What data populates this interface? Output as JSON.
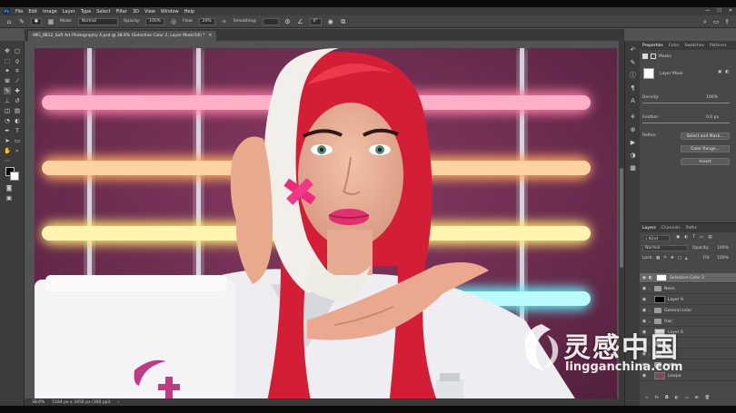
{
  "app": {
    "logo_text": "Ps",
    "menu": [
      "File",
      "Edit",
      "Image",
      "Layer",
      "Type",
      "Select",
      "Filter",
      "3D",
      "View",
      "Window",
      "Help"
    ]
  },
  "options": {
    "mode_label": "Mode:",
    "mode_value": "Normal",
    "opacity_label": "Opacity:",
    "opacity_value": "100%",
    "flow_label": "Flow:",
    "flow_value": "20%",
    "smoothing_label": "Smoothing:",
    "angle_value": "0°"
  },
  "document": {
    "tab_title": "IMG_8812_Soft Art Photography 4.psd @ 38.6% (Selective Color 2, Layer Mask/16) *"
  },
  "properties": {
    "tabs": [
      "Properties",
      "Color",
      "Swatches",
      "Patterns"
    ],
    "section": "Masks",
    "mask_label": "Layer Mask",
    "density_label": "Density:",
    "density_value": "100%",
    "feather_label": "Feather:",
    "feather_value": "0.0 px",
    "refine_label": "Refine:",
    "buttons": [
      "Select and Mask...",
      "Color Range...",
      "Invert"
    ]
  },
  "layers": {
    "tabs": [
      "Layers",
      "Channels",
      "Paths"
    ],
    "kind_value": "Kind",
    "blend_value": "Normal",
    "opacity_label": "Opacity:",
    "opacity_value": "100%",
    "lock_label": "Lock:",
    "fill_label": "Fill:",
    "fill_value": "100%",
    "items": [
      {
        "name": "Selective Color 2",
        "type": "adjust"
      },
      {
        "name": "Neon",
        "type": "folder"
      },
      {
        "name": "Layer 9",
        "type": "black"
      },
      {
        "name": "General color",
        "type": "folder"
      },
      {
        "name": "Hair",
        "type": "folder"
      },
      {
        "name": "Layer 6",
        "type": "light"
      },
      {
        "name": "",
        "type": "folder"
      },
      {
        "name": "",
        "type": "folder"
      },
      {
        "name": "teeth",
        "type": "folder"
      },
      {
        "name": "Lowpa",
        "type": "pic"
      }
    ]
  },
  "status": {
    "zoom": "38.6%",
    "doc_size": "5184 px x 3456 px (300 ppi)"
  },
  "watermark": {
    "chinese": "灵感中国",
    "english": "lingganchina.com"
  },
  "colors": {
    "panel_bg": "#484848",
    "canvas_bg": "#6a2b4a",
    "neon_pink": "#ff8fb0",
    "neon_orange": "#ffb870",
    "neon_yellow": "#fff19a",
    "neon_cyan": "#8ff7ff",
    "hair_red": "#d81f35"
  }
}
